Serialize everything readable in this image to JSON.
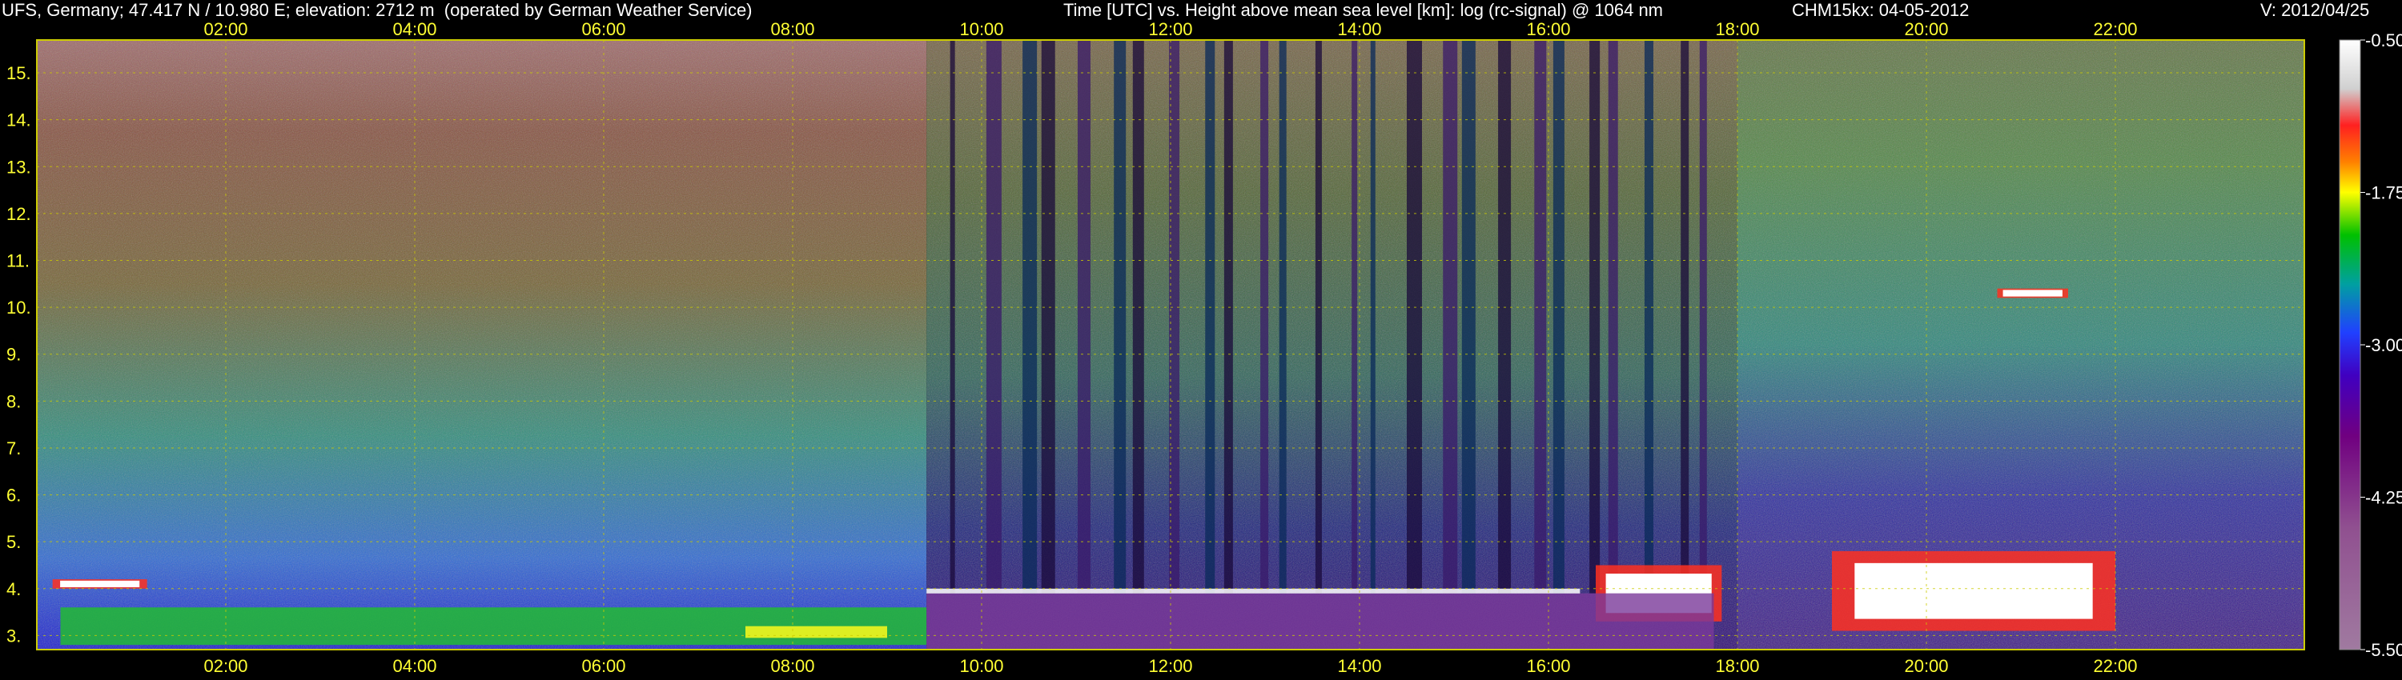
{
  "header": {
    "station": "UFS, Germany; 47.417 N / 10.980 E; elevation: 2712 m  (operated by German Weather Service)",
    "axes_title": "Time [UTC] vs. Height above mean sea level [km]: log (rc-signal) @ 1064 nm",
    "instrument": "CHM15kx: 04-05-2012",
    "version": "V: 2012/04/25"
  },
  "chart_data": {
    "type": "heatmap",
    "title": "Time [UTC] vs. Height above mean sea level [km]: log (rc-signal) @ 1064 nm",
    "xlabel": "Time [UTC]",
    "ylabel": "Height above mean sea level [km]",
    "x_range": [
      "00:00",
      "24:00"
    ],
    "x_ticks": [
      "02:00",
      "04:00",
      "06:00",
      "08:00",
      "10:00",
      "12:00",
      "14:00",
      "16:00",
      "18:00",
      "20:00",
      "22:00"
    ],
    "y_range": [
      2.7,
      15.7
    ],
    "y_ticks": [
      "3.",
      "4.",
      "5.",
      "6.",
      "7.",
      "8.",
      "9.",
      "10.",
      "11.",
      "12.",
      "13.",
      "14.",
      "15."
    ],
    "grid": true,
    "colorbar": {
      "label": "log (rc-signal)",
      "range": [
        -5.5,
        -0.5
      ],
      "ticks": [
        "-0.50",
        "-1.75",
        "-3.00",
        "-4.25",
        "-5.50"
      ],
      "colors": [
        "#ffffff",
        "#d0d0d0",
        "#ff2020",
        "#ff8000",
        "#ffff00",
        "#00c000",
        "#00a0a0",
        "#2040ff",
        "#4000c0",
        "#700080",
        "#905090",
        "#a07aa0"
      ]
    },
    "features": [
      {
        "type": "cloud",
        "start": "19:00",
        "end": "22:00",
        "height_km": [
          3.1,
          4.8
        ]
      },
      {
        "type": "cloud",
        "start": "16:30",
        "end": "17:50",
        "height_km": [
          3.3,
          4.5
        ]
      },
      {
        "type": "cloud",
        "start": "00:10",
        "end": "01:10",
        "height_km": [
          4.0,
          4.2
        ]
      },
      {
        "type": "cloud",
        "start": "20:45",
        "end": "21:30",
        "height_km": [
          10.2,
          10.4
        ]
      },
      {
        "type": "fog",
        "start": "00:15",
        "end": "09:25",
        "height_km": [
          2.8,
          3.6
        ]
      }
    ]
  }
}
